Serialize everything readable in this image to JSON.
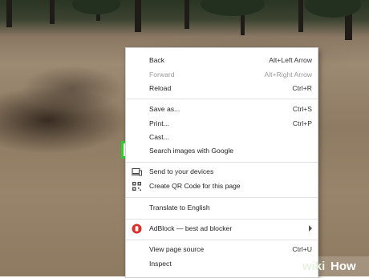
{
  "menu": {
    "back": {
      "label": "Back",
      "shortcut": "Alt+Left Arrow"
    },
    "forward": {
      "label": "Forward",
      "shortcut": "Alt+Right Arrow"
    },
    "reload": {
      "label": "Reload",
      "shortcut": "Ctrl+R"
    },
    "save_as": {
      "label": "Save as...",
      "shortcut": "Ctrl+S"
    },
    "print": {
      "label": "Print...",
      "shortcut": "Ctrl+P"
    },
    "cast": {
      "label": "Cast..."
    },
    "search_images": {
      "label": "Search images with Google"
    },
    "send_devices": {
      "label": "Send to your devices",
      "icon": "device-icon"
    },
    "qr_code": {
      "label": "Create QR Code for this page",
      "icon": "qr-code-icon"
    },
    "translate": {
      "label": "Translate to English"
    },
    "adblock": {
      "label": "AdBlock — best ad blocker",
      "icon": "adblock-icon"
    },
    "view_source": {
      "label": "View page source",
      "shortcut": "Ctrl+U"
    },
    "inspect": {
      "label": "Inspect"
    }
  },
  "colors": {
    "highlight_border": "#2fd02f",
    "adblock_red": "#d9302b"
  },
  "watermark": {
    "part1": "wiki",
    "part2": "How"
  }
}
